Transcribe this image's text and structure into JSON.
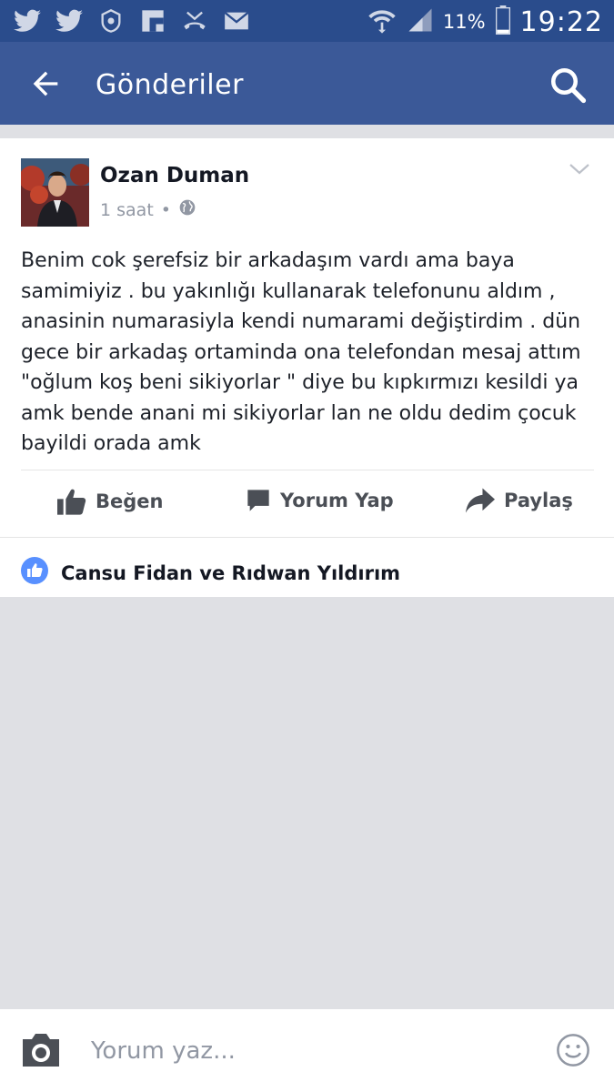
{
  "status_bar": {
    "battery_percent": "11%",
    "time": "19:22",
    "icons": [
      "twitter-icon",
      "twitter-icon",
      "vodafone-icon",
      "flipboard-icon",
      "missed-call-icon",
      "mail-icon",
      "wifi-icon",
      "signal-icon",
      "battery-icon"
    ]
  },
  "app_bar": {
    "title": "Gönderiler",
    "back_icon": "arrow-left-icon",
    "search_icon": "search-icon"
  },
  "post": {
    "author": "Ozan Duman",
    "time": "1 saat",
    "separator": "•",
    "privacy_icon": "globe-icon",
    "menu_icon": "chevron-down-icon",
    "text": "Benim cok şerefsiz bir arkadaşım vardı ama baya samimiyiz . bu yakınlığı kullanarak telefonunu aldım , anasinin numarasiyla kendi numarami değiştirdim . dün gece bir arkadaş ortaminda ona telefondan mesaj attım \"oğlum koş beni sikiyorlar \" diye bu kıpkırmızı kesildi ya amk bende anani mi sikiyorlar lan ne oldu dedim çocuk bayildi orada amk",
    "actions": {
      "like": "Beğen",
      "comment": "Yorum Yap",
      "share": "Paylaş"
    },
    "likers": "Cansu Fidan ve Rıdwan Yıldırım"
  },
  "composer": {
    "placeholder": "Yorum yaz...",
    "camera_icon": "camera-icon",
    "emoji_icon": "smiley-icon"
  },
  "colors": {
    "status_bar": "#2a4c8c",
    "app_bar": "#3b5998",
    "like_badge": "#5890ff",
    "background": "#dfe0e4"
  }
}
